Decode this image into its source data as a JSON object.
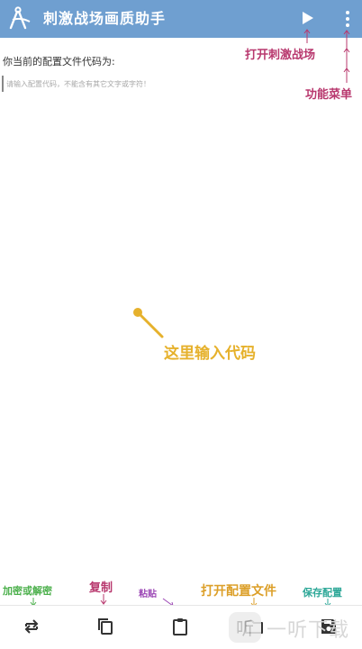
{
  "app_bar": {
    "title": "刺激战场画质助手",
    "logo_icon": "compass-logo-icon",
    "play_icon": "play-icon",
    "menu_icon": "more-vert-icon",
    "color": "#6f9fd0"
  },
  "editor": {
    "prompt": "你当前的配置文件代码为:",
    "placeholder": "请输入配置代码，不能含有其它文字或字符！"
  },
  "annotations": {
    "play": "打开刺激战场",
    "menu": "功能菜单",
    "input": "这里输入代码",
    "encrypt": "加密或解密",
    "copy": "复制",
    "paste": "粘贴",
    "open": "打开配置文件",
    "save": "保存配置"
  },
  "toolbar": {
    "encrypt_icon": "repeat-icon",
    "copy_icon": "copy-icon",
    "paste_icon": "clipboard-icon",
    "open_icon": "folder-icon",
    "save_icon": "save-icon"
  },
  "watermark": {
    "text": "一听下载",
    "logo_text": "听"
  }
}
